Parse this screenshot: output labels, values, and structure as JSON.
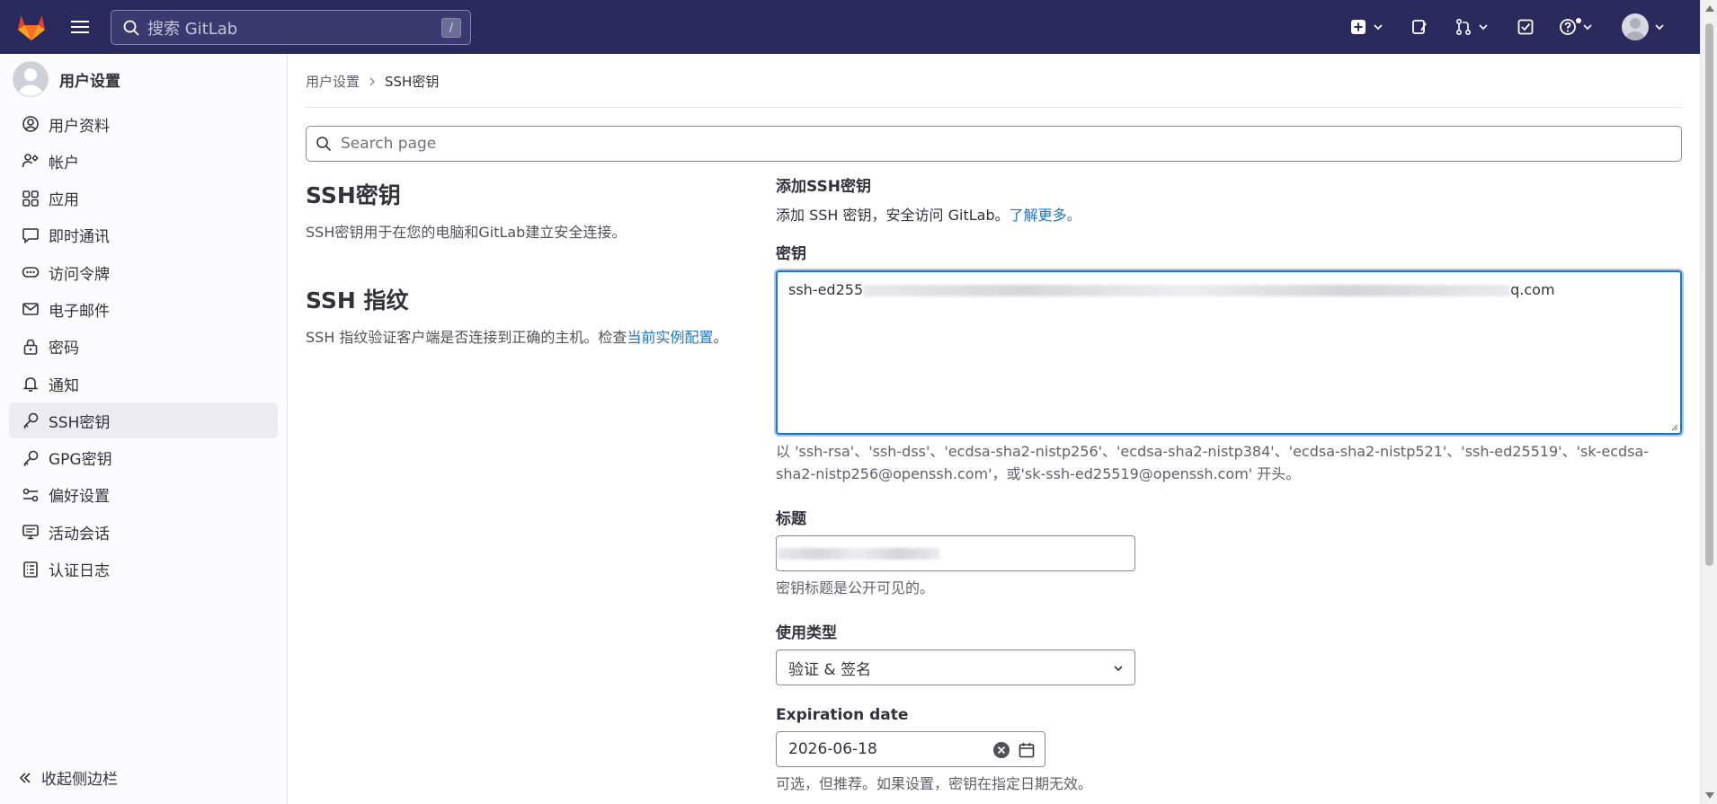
{
  "topbar": {
    "search_placeholder": "搜索 GitLab",
    "search_shortcut": "/"
  },
  "sidebar": {
    "title": "用户设置",
    "items": [
      {
        "label": "用户资料",
        "icon": "profile-icon"
      },
      {
        "label": "帐户",
        "icon": "account-icon"
      },
      {
        "label": "应用",
        "icon": "applications-icon"
      },
      {
        "label": "即时通讯",
        "icon": "chat-icon"
      },
      {
        "label": "访问令牌",
        "icon": "token-icon"
      },
      {
        "label": "电子邮件",
        "icon": "mail-icon"
      },
      {
        "label": "密码",
        "icon": "lock-icon"
      },
      {
        "label": "通知",
        "icon": "bell-icon"
      },
      {
        "label": "SSH密钥",
        "icon": "key-icon",
        "active": true
      },
      {
        "label": "GPG密钥",
        "icon": "key-icon"
      },
      {
        "label": "偏好设置",
        "icon": "preferences-icon"
      },
      {
        "label": "活动会话",
        "icon": "monitor-icon"
      },
      {
        "label": "认证日志",
        "icon": "log-icon"
      }
    ],
    "collapse_label": "收起侧边栏"
  },
  "breadcrumb": {
    "parent": "用户设置",
    "current": "SSH密钥"
  },
  "page_search": {
    "placeholder": "Search page"
  },
  "ssh_keys_section": {
    "title": "SSH密钥",
    "description": "SSH密钥用于在您的电脑和GitLab建立安全连接。"
  },
  "fingerprint_section": {
    "title": "SSH 指纹",
    "description": "SSH 指纹验证客户端是否连接到正确的主机。检查",
    "link": "当前实例配置",
    "suffix": "。"
  },
  "add_key": {
    "heading": "添加SSH密钥",
    "intro": "添加 SSH 密钥，安全访问 GitLab。",
    "learn_more": "了解更多。",
    "key_label": "密钥",
    "key_value_start": "ssh-ed255",
    "key_value_end": "q.com",
    "key_help": "以 'ssh-rsa'、'ssh-dss'、'ecdsa-sha2-nistp256'、'ecdsa-sha2-nistp384'、'ecdsa-sha2-nistp521'、'ssh-ed25519'、'sk-ecdsa-sha2-nistp256@openssh.com'，或'sk-ssh-ed25519@openssh.com' 开头。",
    "title_label": "标题",
    "title_help": "密钥标题是公开可见的。",
    "usage_label": "使用类型",
    "usage_value": "验证 & 签名",
    "expiration_label": "Expiration date",
    "expiration_value": "2026-06-18",
    "expiration_help": "可选，但推荐。如果设置，密钥在指定日期无效。"
  },
  "colors": {
    "topbar_bg": "#2b2a5e",
    "link": "#1f75cb",
    "focus_border": "#1f75cb",
    "sidebar_bg": "#fbfafd"
  }
}
